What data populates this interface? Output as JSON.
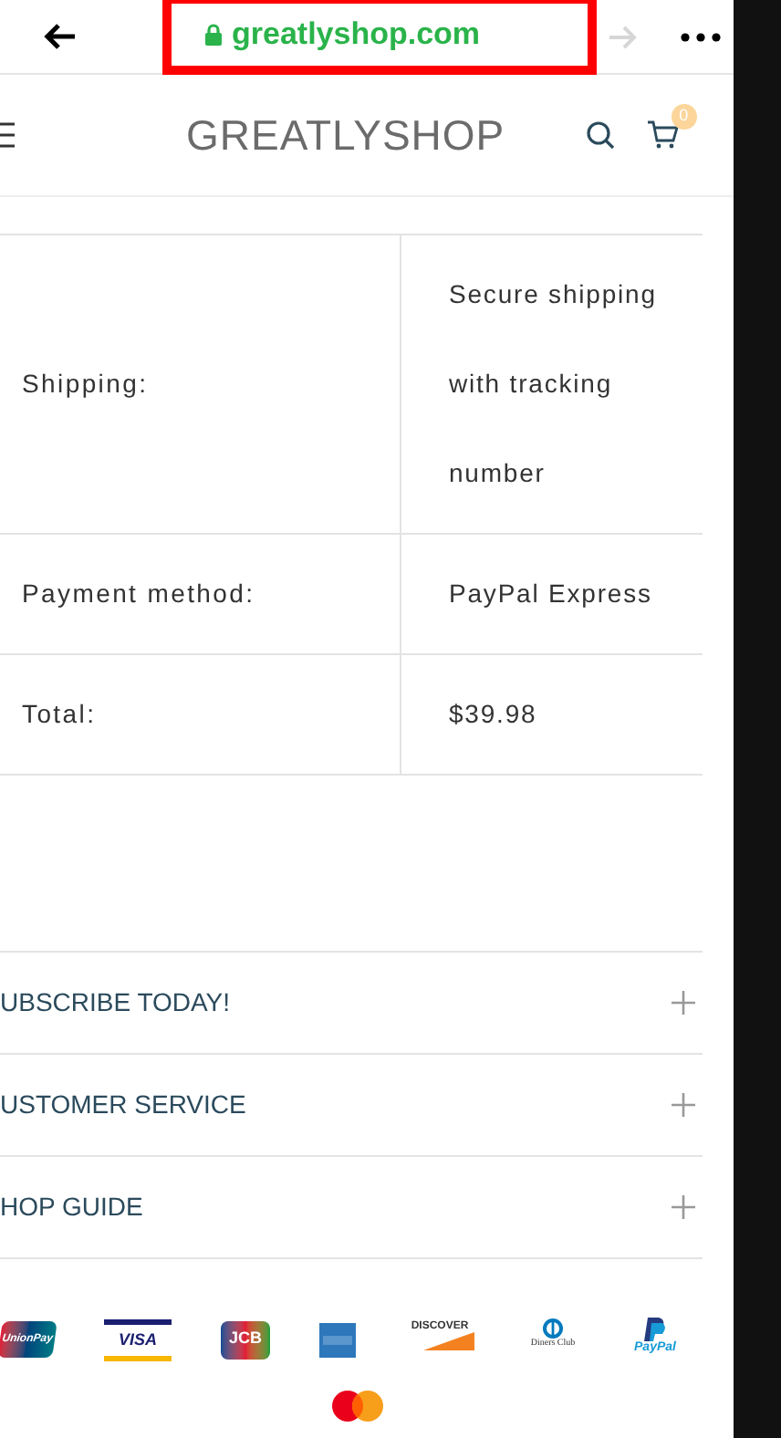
{
  "browser_bar": {
    "url": "greatlyshop.com",
    "secure": true,
    "forward_disabled": true
  },
  "header": {
    "brand": "GREATLYSHOP",
    "cart_count": "0"
  },
  "order_summary": [
    {
      "label": "Shipping:",
      "value": "Secure shipping with tracking number"
    },
    {
      "label": "Payment method:",
      "value": "PayPal Express"
    },
    {
      "label": "Total:",
      "value": "$39.98"
    }
  ],
  "accordion": [
    {
      "title": "UBSCRIBE TODAY!",
      "expanded": false
    },
    {
      "title": "USTOMER SERVICE",
      "expanded": false
    },
    {
      "title": "HOP GUIDE",
      "expanded": false
    }
  ],
  "payment_methods": [
    {
      "kind": "unionpay",
      "label": "UnionPay"
    },
    {
      "kind": "visa",
      "label": "VISA"
    },
    {
      "kind": "jcb",
      "label": "JCB"
    },
    {
      "kind": "amex"
    },
    {
      "kind": "discover",
      "label": "DISCOVER"
    },
    {
      "kind": "diners",
      "label": "Diners Club"
    },
    {
      "kind": "paypal",
      "label": "PayPal"
    },
    {
      "kind": "mastercard"
    }
  ]
}
